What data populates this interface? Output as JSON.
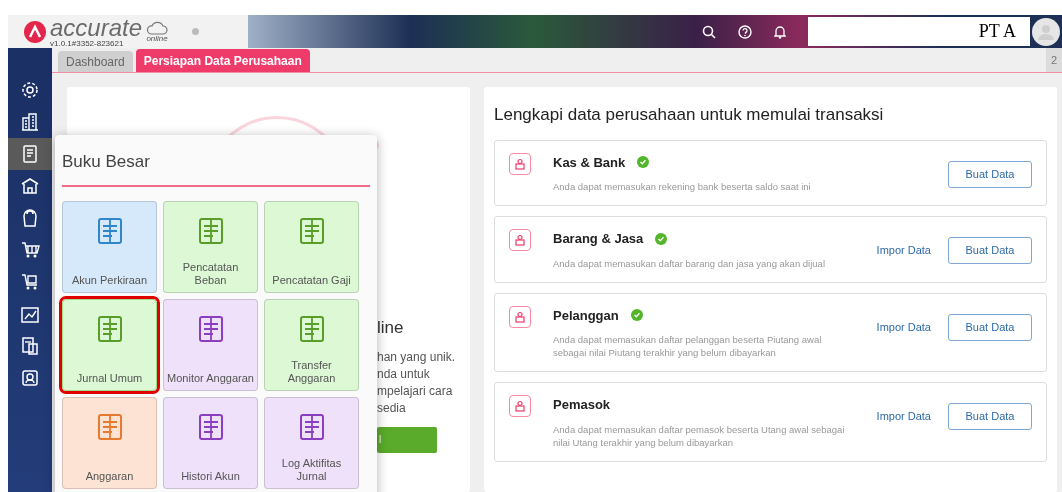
{
  "header": {
    "logo_text": "accurate",
    "cloud_label": "online",
    "version": "v1.0.1#3352-823621",
    "company": "PT A"
  },
  "tabs": [
    {
      "label": "Dashboard",
      "selected": false
    },
    {
      "label": "Persiapan Data Perusahaan",
      "selected": true
    }
  ],
  "tab_counter": "2",
  "sidebar": {
    "items": [
      {
        "selected": false
      },
      {
        "selected": false
      },
      {
        "selected": true
      },
      {
        "selected": false
      },
      {
        "selected": false
      },
      {
        "selected": false
      },
      {
        "selected": false
      },
      {
        "selected": false
      },
      {
        "selected": false
      },
      {
        "selected": false
      }
    ]
  },
  "background_card": {
    "title_fragment": "line",
    "text_fragments": [
      "han yang unik.",
      "nda untuk",
      "mpelajari cara",
      "sedia"
    ],
    "button_fragment": "l"
  },
  "menu": {
    "title": "Buku Besar",
    "tiles": [
      {
        "label": "Akun Perkiraan",
        "color": "#d6e9fb",
        "selected": false
      },
      {
        "label": "Pencatatan Beban",
        "color": "#dcf8d4",
        "selected": false
      },
      {
        "label": "Pencatatan Gaji",
        "color": "#dcf8d4",
        "selected": false
      },
      {
        "label": "Jurnal Umum",
        "color": "#dcf8d4",
        "selected": true
      },
      {
        "label": "Monitor Anggaran",
        "color": "#efe1fa",
        "selected": false
      },
      {
        "label": "Transfer Anggaran",
        "color": "#dcf8d4",
        "selected": false
      },
      {
        "label": "Anggaran",
        "color": "#fde3d3",
        "selected": false
      },
      {
        "label": "Histori Akun",
        "color": "#efe1fa",
        "selected": false
      },
      {
        "label": "Log Aktifitas Jurnal",
        "color": "#efe1fa",
        "selected": false
      }
    ]
  },
  "setup": {
    "title": "Lengkapi data perusahaan untuk memulai transaksi",
    "sections": [
      {
        "title": "Kas & Bank",
        "done": true,
        "description": "Anda dapat memasukan rekening bank beserta saldo saat ini",
        "button": "Buat Data"
      },
      {
        "title": "Barang & Jasa",
        "done": true,
        "description": "Anda dapat memasukan daftar barang dan jasa yang akan dijual",
        "import_link": "Impor Data",
        "button": "Buat Data"
      },
      {
        "title": "Pelanggan",
        "done": true,
        "description": "Anda dapat memasukan daftar pelanggan beserta Piutang awal sebagai nilai Piutang terakhir yang belum dibayarkan",
        "import_link": "Impor Data",
        "button": "Buat Data"
      },
      {
        "title": "Pemasok",
        "done": false,
        "description": "Anda dapat memasukan daftar pemasok beserta Utang awal sebagai nilai Utang terakhir yang belum dibayarkan",
        "import_link": "Impor Data",
        "button": "Buat Data"
      }
    ]
  }
}
